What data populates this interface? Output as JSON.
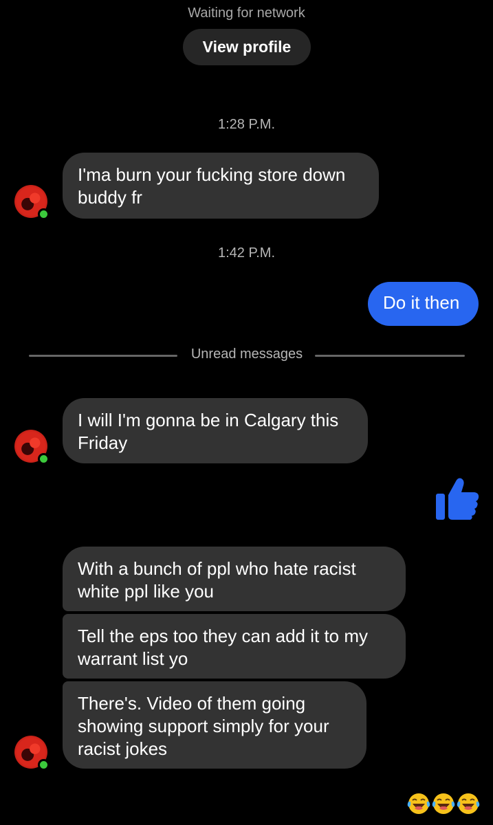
{
  "header": {
    "status": "Waiting for network",
    "view_profile_label": "View profile"
  },
  "timestamps": [
    "1:28 P.M.",
    "1:42 P.M."
  ],
  "messages": [
    {
      "text": "I'ma burn your fucking store down buddy fr",
      "direction": "incoming"
    },
    {
      "text": "Do it then",
      "direction": "outgoing"
    },
    {
      "text": "I will I'm gonna be in Calgary this Friday",
      "direction": "incoming"
    },
    {
      "text": "With a bunch of ppl who hate racist white ppl like you",
      "direction": "incoming"
    },
    {
      "text": "Tell the eps too they can add it to my warrant list yo",
      "direction": "incoming"
    },
    {
      "text": "There's. Video of them going showing support simply for your racist jokes",
      "direction": "incoming"
    }
  ],
  "divider": {
    "label": "Unread messages"
  },
  "outgoing_like": {
    "icon": "thumbs-up-icon"
  },
  "reactions": {
    "icons": [
      "laughing-tears-emoji-icon",
      "laughing-tears-emoji-icon",
      "laughing-tears-emoji-icon"
    ]
  },
  "colors": {
    "background": "#000000",
    "incoming_bubble": "#333333",
    "outgoing_bubble": "#2866f0",
    "online_indicator": "#3cc93c"
  }
}
